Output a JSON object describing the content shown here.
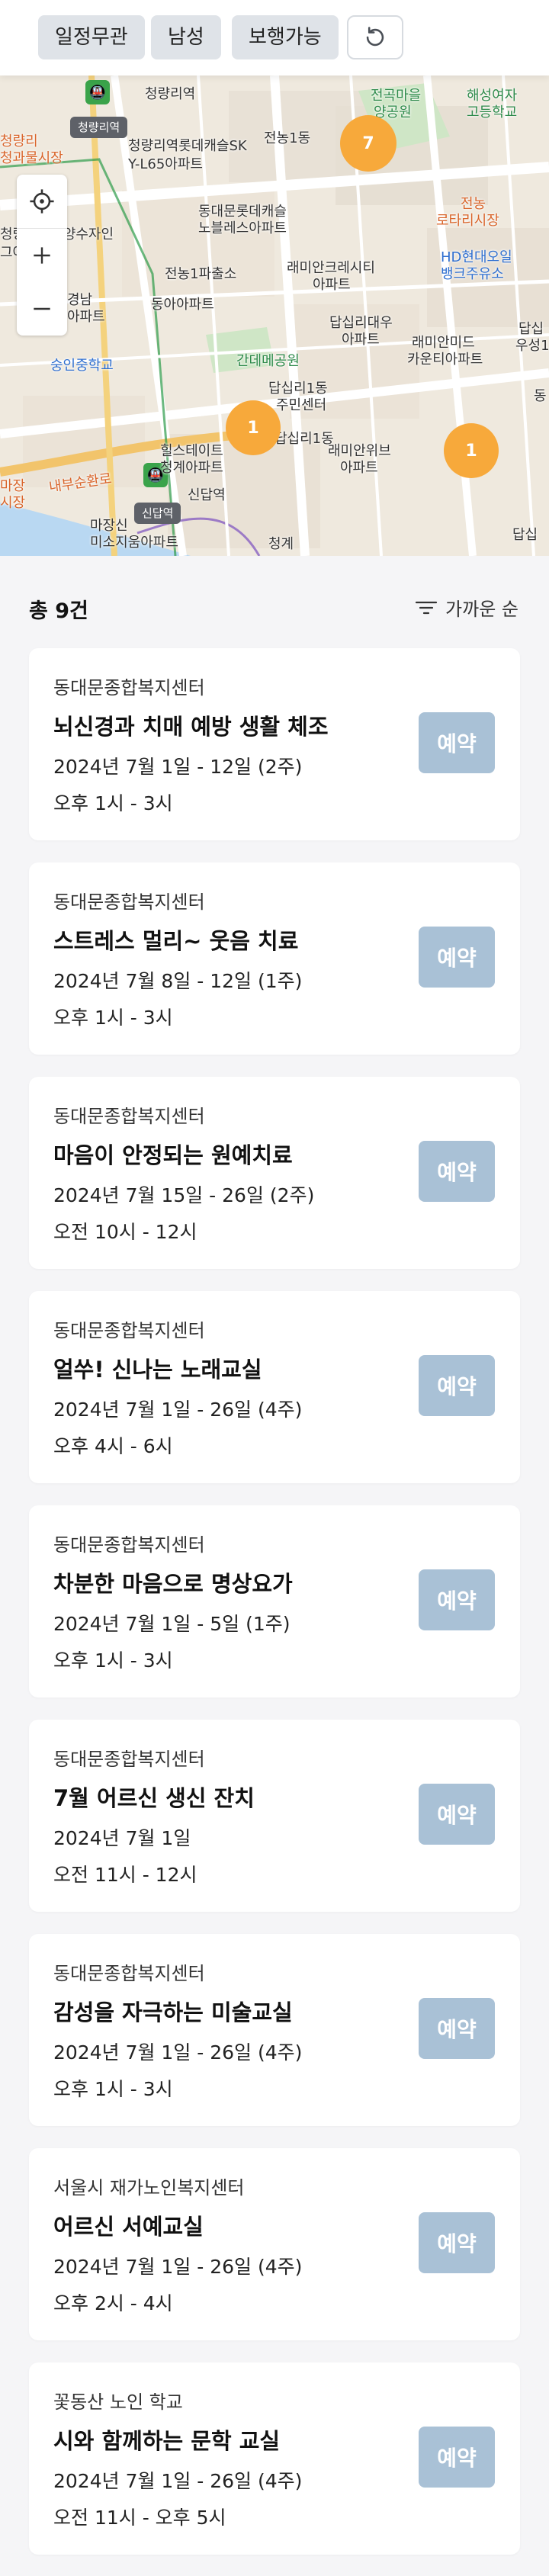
{
  "filters": {
    "schedule": "일정무관",
    "gender": "남성",
    "walking": "보행가능"
  },
  "map": {
    "station_tags": [
      "청량리역",
      "신답역"
    ],
    "cluster_counts": [
      "7",
      "1",
      "1"
    ],
    "labels": [
      "청량리역",
      "청량리역롯데캐슬SK",
      "Y-L65아파트",
      "청량리",
      "청과물시장",
      "청량리역한양수자인",
      "그아파트",
      "동대문롯데캐슬",
      "노블레스아파트",
      "전농1파출소",
      "동아아파트",
      "경남",
      "아파트",
      "숭인중학교",
      "래미안크레시티",
      "아파트",
      "전농1동",
      "전곡마을",
      "양공원",
      "해성여자",
      "고등학교",
      "전농",
      "로타리시장",
      "HD현대오일",
      "뱅크주유소",
      "답십리대우",
      "아파트",
      "래미안미드",
      "카운티아파트",
      "답십",
      "우성1",
      "간데메공원",
      "답십리1동",
      "주민센터",
      "답십리1동",
      "래미안위브",
      "아파트",
      "힐스테이트",
      "청계아파트",
      "신답역",
      "마장",
      "시장",
      "마장신",
      "미소지움아파트",
      "내부순환로",
      "청계",
      "답십",
      "동"
    ]
  },
  "results": {
    "count_label": "총 9건",
    "sort_label": "가까운 순"
  },
  "programs": [
    {
      "center": "동대문종합복지센터",
      "title": "뇌신경과 치매 예방 생활 체조",
      "dates": "2024년 7월 1일 - 12일 (2주)",
      "time": "오후 1시 - 3시",
      "button": "예약"
    },
    {
      "center": "동대문종합복지센터",
      "title": "스트레스 멀리~ 웃음 치료",
      "dates": "2024년 7월 8일 - 12일 (1주)",
      "time": "오후 1시 - 3시",
      "button": "예약"
    },
    {
      "center": "동대문종합복지센터",
      "title": "마음이 안정되는 원예치료",
      "dates": "2024년 7월 15일 - 26일 (2주)",
      "time": "오전 10시 - 12시",
      "button": "예약"
    },
    {
      "center": "동대문종합복지센터",
      "title": "얼쑤! 신나는 노래교실",
      "dates": "2024년 7월 1일 - 26일 (4주)",
      "time": "오후 4시 - 6시",
      "button": "예약"
    },
    {
      "center": "동대문종합복지센터",
      "title": "차분한 마음으로 명상요가",
      "dates": "2024년 7월 1일 - 5일 (1주)",
      "time": "오후 1시 - 3시",
      "button": "예약"
    },
    {
      "center": "동대문종합복지센터",
      "title": "7월 어르신 생신 잔치",
      "dates": "2024년 7월 1일",
      "time": "오전 11시 - 12시",
      "button": "예약"
    },
    {
      "center": "동대문종합복지센터",
      "title": "감성을 자극하는 미술교실",
      "dates": "2024년 7월 1일 - 26일 (4주)",
      "time": "오후 1시 - 3시",
      "button": "예약"
    },
    {
      "center": "서울시 재가노인복지센터",
      "title": "어르신 서예교실",
      "dates": "2024년 7월 1일 - 26일 (4주)",
      "time": "오후 2시 - 4시",
      "button": "예약"
    },
    {
      "center": "꽃동산 노인 학교",
      "title": "시와 함께하는 문학 교실",
      "dates": "2024년 7월 1일 - 26일 (4주)",
      "time": "오전 11시 - 오후 5시",
      "button": "예약"
    }
  ]
}
